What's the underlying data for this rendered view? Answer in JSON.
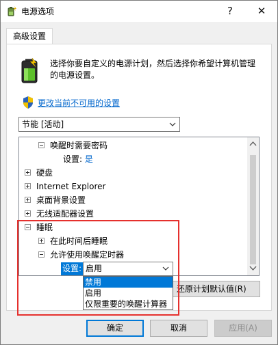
{
  "window": {
    "title": "电源选项",
    "help_glyph": "?",
    "close_glyph": "✕",
    "icon": "power-options-icon"
  },
  "tabs": [
    {
      "label": "高级设置",
      "active": true
    }
  ],
  "intro": {
    "line1": "选择你要自定义的电源计划，然后选择你希望计算机管理",
    "line2": "的电源设置。",
    "icon": "battery-icon"
  },
  "change_link": {
    "label": "更改当前不可用的设置",
    "icon": "uac-shield-icon"
  },
  "plan_select": {
    "value": "节能 [活动]"
  },
  "tree": {
    "rows": [
      {
        "label": "唤醒时需要密码",
        "expander": "minus"
      },
      {
        "label": "设置:",
        "value": "是"
      },
      {
        "label": "硬盘",
        "expander": "plus"
      },
      {
        "label": "Internet Explorer",
        "expander": "plus"
      },
      {
        "label": "桌面背景设置",
        "expander": "plus"
      },
      {
        "label": "无线适配器设置",
        "expander": "plus"
      },
      {
        "label": "睡眠",
        "expander": "minus"
      },
      {
        "label": "在此时间后睡眠",
        "expander": "plus"
      },
      {
        "label": "允许使用唤醒定时器",
        "expander": "minus"
      }
    ],
    "setting_label": "设置:",
    "setting_value": "启用"
  },
  "dropdown": {
    "options": [
      "禁用",
      "启用",
      "仅限重要的唤醒计算器"
    ],
    "highlighted_index": 0
  },
  "restore_button": {
    "label": "还原计划默认值(R)"
  },
  "buttons": {
    "ok": "确定",
    "cancel": "取消",
    "apply": "应用(A)"
  },
  "colors": {
    "accent": "#0078d7",
    "link": "#0066cc",
    "highlight_box": "#e5302d"
  }
}
